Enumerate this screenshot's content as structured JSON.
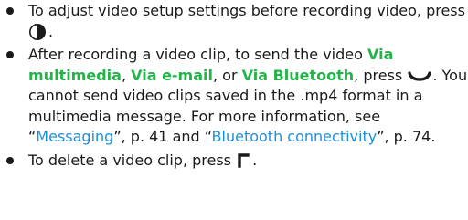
{
  "bullets": {
    "b1": {
      "text_before": "To adjust video setup settings before recording video, press",
      "text_after": ".",
      "icon": "navigation-key-right-icon"
    },
    "b2": {
      "text_1": "After recording a video clip, to send the video ",
      "opt_mms": "Via multimedia",
      "sep_1": ", ",
      "opt_email": "Via e-mail",
      "sep_2": ", or ",
      "opt_bt": "Via Bluetooth",
      "text_2": ", press",
      "text_3": ". You cannot send video clips saved in the .mp4 format in a multimedia message. For more information, see “",
      "link_messaging": "Messaging",
      "text_4": "”, p. 41 and “",
      "link_bluetooth": "Bluetooth connectivity",
      "text_5": "”, p. 74.",
      "icon": "call-key-icon"
    },
    "b3": {
      "text_before": "To delete a video clip, press",
      "text_after": ".",
      "icon": "clear-key-icon"
    }
  },
  "colors": {
    "option_green": "#24b24a",
    "link_blue": "#1e8fd6",
    "text": "#1a1a1a"
  }
}
